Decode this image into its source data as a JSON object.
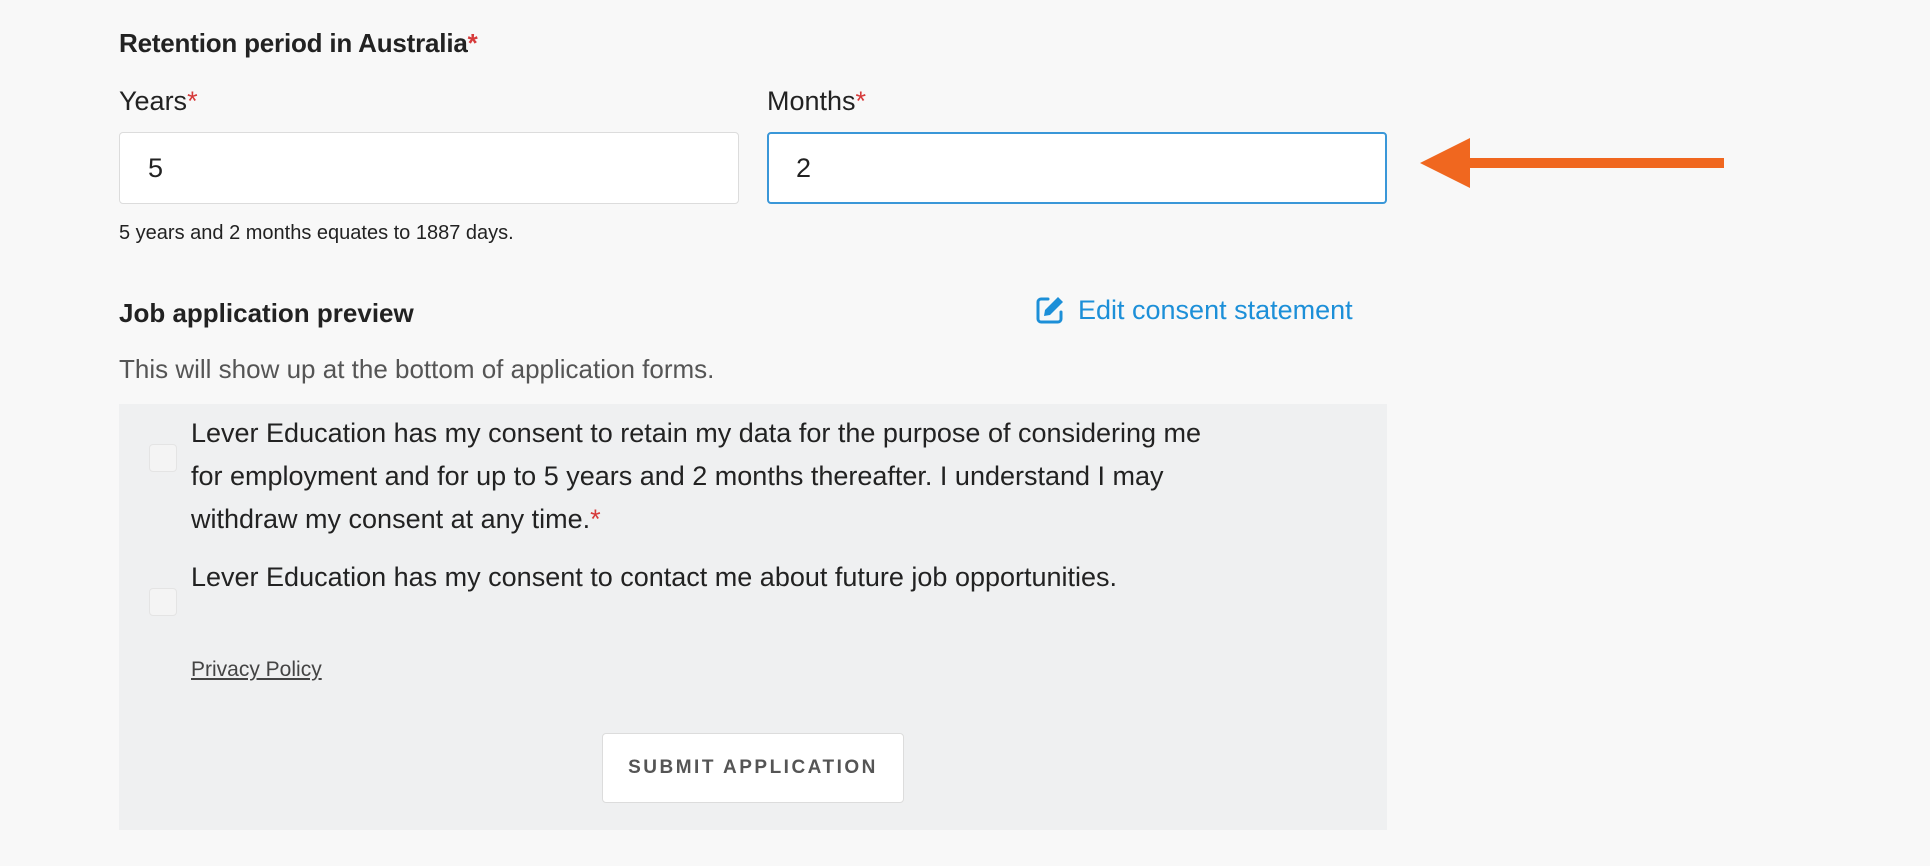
{
  "retention": {
    "title": "Retention period in Australia",
    "required_mark": "*",
    "years": {
      "label": "Years",
      "value": "5"
    },
    "months": {
      "label": "Months",
      "value": "2"
    },
    "hint": "5 years and 2 months equates to 1887 days."
  },
  "preview": {
    "title": "Job application preview",
    "edit_link_label": "Edit consent statement",
    "subtitle": "This will show up at the bottom of application forms.",
    "consents": [
      {
        "text": "Lever Education has my consent to retain my data for the purpose of considering me for employment and for up to 5 years and 2 months thereafter. I understand I may withdraw my consent at any time.",
        "required_mark": "*",
        "checked": false
      },
      {
        "text": "Lever Education has my consent to contact me about future job opportunities.",
        "checked": false
      }
    ],
    "privacy_link": "Privacy Policy",
    "submit_label": "SUBMIT APPLICATION"
  },
  "icons": {
    "edit": "edit-icon",
    "arrow": "arrow-left-icon"
  },
  "colors": {
    "accent": "#1c8fd8",
    "required": "#d63a3a",
    "annotation_arrow": "#f0671f",
    "focus_border": "#3a97d8"
  }
}
